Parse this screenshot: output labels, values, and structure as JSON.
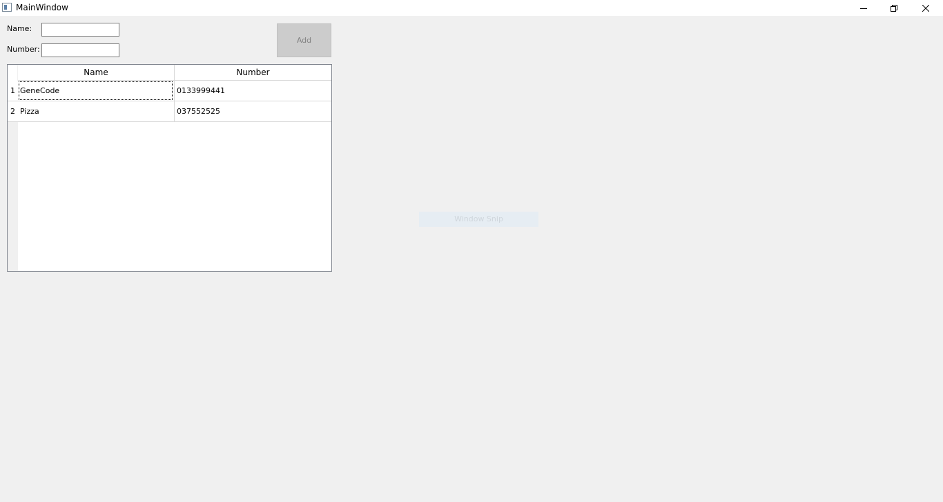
{
  "window": {
    "title": "MainWindow"
  },
  "icons": {
    "app": "app-window-icon",
    "minimize": "minimize-icon",
    "maximize": "restore-icon",
    "close": "close-icon"
  },
  "form": {
    "name_label": "Name:",
    "name_value": "",
    "number_label": "Number:",
    "number_value": "",
    "add_label": "Add"
  },
  "table": {
    "columns": [
      "Name",
      "Number"
    ],
    "row_numbers": [
      "1",
      "2"
    ],
    "rows": [
      {
        "name": "GeneCode",
        "number": "0133999441"
      },
      {
        "name": "Pizza",
        "number": "037552525"
      }
    ]
  },
  "overlay": {
    "text": "Window Snip"
  },
  "colors": {
    "background": "#f0f0f0",
    "add_disabled_bg": "#cccccc",
    "add_disabled_text": "#838383"
  }
}
